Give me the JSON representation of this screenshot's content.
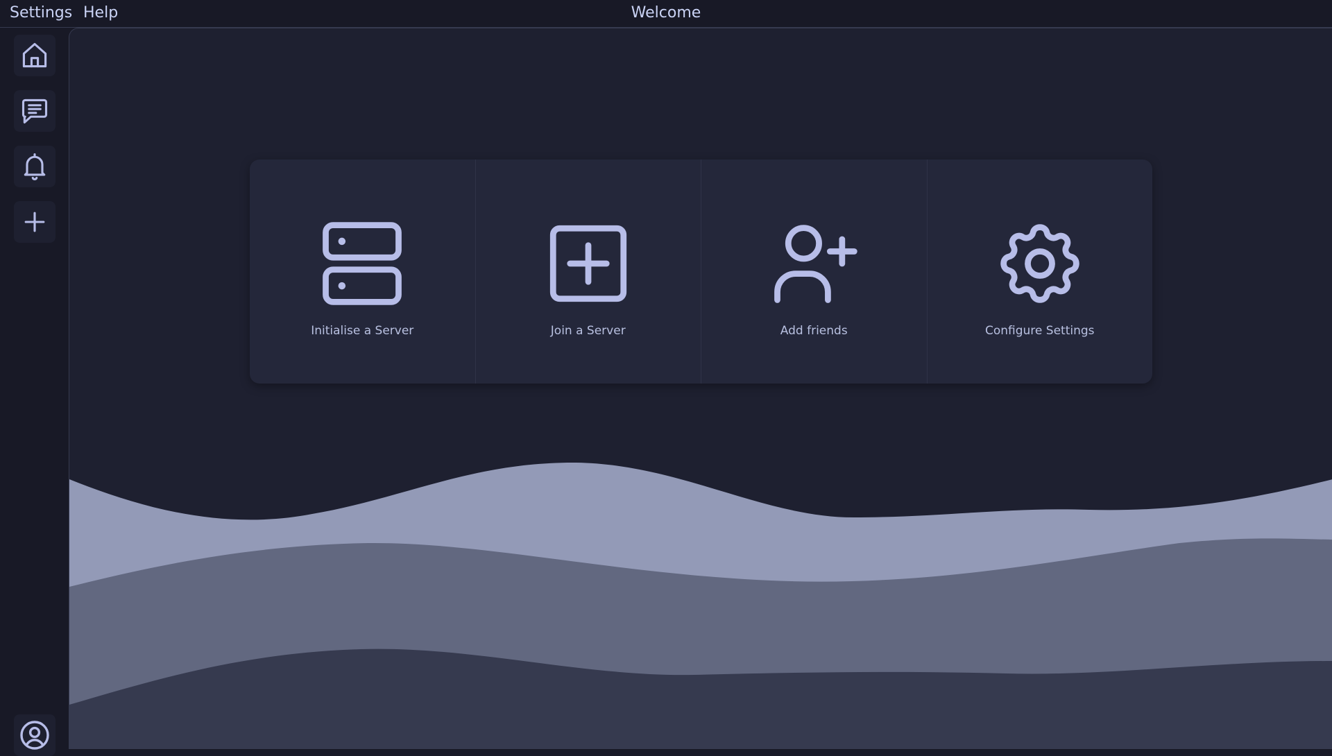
{
  "menubar": {
    "settings_label": "Settings",
    "help_label": "Help",
    "title": "Welcome"
  },
  "sidebar": {
    "items": [
      {
        "icon": "home-icon"
      },
      {
        "icon": "chat-icon"
      },
      {
        "icon": "bell-icon"
      },
      {
        "icon": "plus-icon"
      }
    ],
    "profile_icon": "user-circle-icon"
  },
  "actions": [
    {
      "label": "Initialise a Server",
      "icon": "server-icon"
    },
    {
      "label": "Join a Server",
      "icon": "square-plus-icon"
    },
    {
      "label": "Add friends",
      "icon": "user-plus-icon"
    },
    {
      "label": "Configure Settings",
      "icon": "gear-icon"
    }
  ],
  "colors": {
    "background": "#181926",
    "main": "#1e2030",
    "card": "#24273a",
    "icon": "#b7bde8",
    "wave_light": "#939ab7",
    "wave_mid": "#626880",
    "wave_dark": "#363a4f"
  }
}
